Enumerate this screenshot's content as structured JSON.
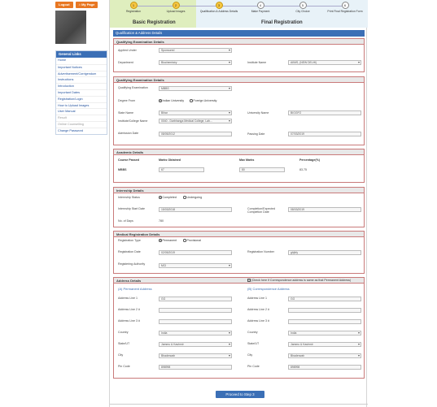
{
  "top": {
    "logout": "Logout",
    "my_page": "My Page"
  },
  "nav": {
    "header": "General Links",
    "items": [
      {
        "label": "Home"
      },
      {
        "label": "Important Notices"
      },
      {
        "label": "Advertisement/Corrigendum"
      },
      {
        "label": "Instructions"
      },
      {
        "label": "Introduction"
      },
      {
        "label": "Important Dates"
      },
      {
        "label": "Registration/Login"
      },
      {
        "label": "How to Upload Images"
      },
      {
        "label": "User Manual"
      },
      {
        "label": "Result"
      },
      {
        "label": "Online Counselling"
      },
      {
        "label": "Change Password"
      }
    ]
  },
  "steps": [
    {
      "num": "1",
      "label": "Registration"
    },
    {
      "num": "2",
      "label": "Upload Images"
    },
    {
      "num": "3",
      "label": "Qualification & Address Details"
    },
    {
      "num": "4",
      "label": "Make Payment"
    },
    {
      "num": "5",
      "label": "City Choice"
    },
    {
      "num": "6",
      "label": "Print Final Registration Form"
    }
  ],
  "phases": {
    "basic": "Basic Registration",
    "final": "Final Registration"
  },
  "section_title": "Qualification & Address Details",
  "qual1": {
    "title": "Qualifying Examination Details",
    "applied_under_label": "Applied Under",
    "applied_under": "Sponsored",
    "department_label": "Department",
    "department": "Biochemistry",
    "institute_label": "Institute Name",
    "institute": "AIIMS, (NEW DELHI)"
  },
  "qual2": {
    "title": "Qualifying Examination Details",
    "qual_exam_label": "Qualifying Examination",
    "qual_exam": "MBBS",
    "degree_from_label": "Degree From",
    "degree_indian": "Indian University",
    "degree_foreign": "Foreign University",
    "state_label": "State Name",
    "state": "Bihar",
    "university_label": "University Name",
    "university": "BIGGFO",
    "inst_label": "Institute/College Name",
    "inst": "0040 - Darbhanga Medical College, Lah...",
    "admission_label": "Admission Date",
    "admission": "08/05/2012",
    "passing_label": "Passing Date",
    "passing": "07/03/2019"
  },
  "academic": {
    "title": "Academic Details",
    "col_course": "Course Passed",
    "col_marks": "Marks Obtained",
    "col_max": "Max Marks",
    "col_pct": "Percentage(%)",
    "course": "MBBS",
    "marks": "67",
    "max": "80",
    "pct": "83.75"
  },
  "internship": {
    "title": "Internship Details",
    "status_label": "Internship Status",
    "completed": "Completed",
    "undergoing": "Undergoing",
    "start_label": "Internship Start Date",
    "start": "15/03/2018",
    "completion_label": "Completion/Expected Completion Date",
    "completion": "08/03/2019",
    "days_label": "No. of Days",
    "days": "780"
  },
  "medical": {
    "title": "Medical Registration Details",
    "type_label": "Registration Type",
    "permanent": "Permanent",
    "provisional": "Provisional",
    "reg_date_label": "Registration Date",
    "reg_date": "02/05/2019",
    "reg_no_label": "Registration Number",
    "reg_no": "ghjhfy",
    "authority_label": "Registering Authority",
    "authority": "MCI"
  },
  "address": {
    "title": "Address Details",
    "same_note": "(Check here if Correspondence address is same as that Permanent Address)",
    "perm_title": "(A) Permanent Address",
    "corr_title": "(B) Correspondence Address",
    "line1_label": "Address Line 1",
    "line2_label": "Address Line 2 #",
    "line3_label": "Address Line 3 #",
    "country_label": "Country",
    "state_label": "State/UT",
    "city_label": "City",
    "pin_label": "Pin Code",
    "perm": {
      "line1": "GG",
      "line2": "",
      "line3": "",
      "country": "India",
      "state": "Jammu & Kashmir",
      "city": "Bhaderwah",
      "pin": "898998"
    },
    "corr": {
      "line1": "GG",
      "line2": "",
      "line3": "",
      "country": "India",
      "state": "Jammu & Kashmir",
      "city": "Bhaderwah",
      "pin": "898998"
    }
  },
  "proceed": "Proceed to Step 3"
}
